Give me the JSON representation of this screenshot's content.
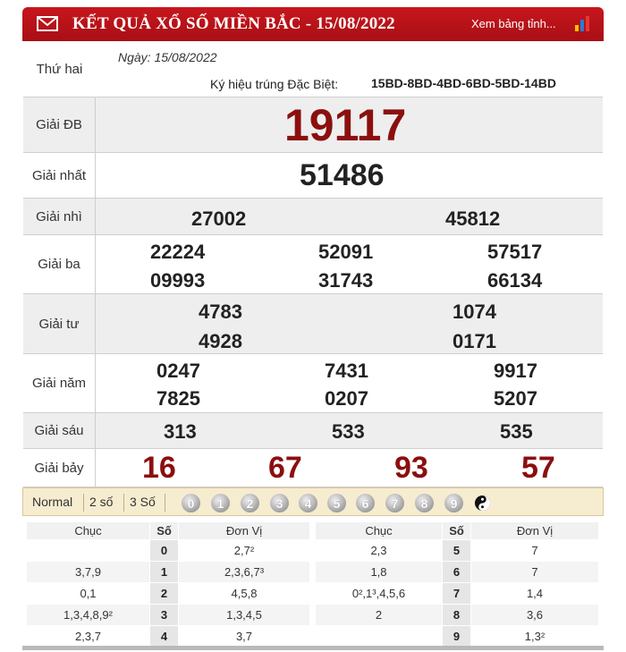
{
  "header": {
    "title": "KẾT QUẢ XỔ SỐ MIỀN BẮC - 15/08/2022",
    "link": "Xem bảng tỉnh...",
    "icons": [
      "envelope-icon",
      "bar-chart-icon"
    ],
    "color": "#c8161d"
  },
  "info": {
    "weekday": "Thứ hai",
    "date": "Ngày: 15/08/2022",
    "special_code_label": "Ký hiệu trúng Đặc Biệt:",
    "special_code": "15BD-8BD-4BD-6BD-5BD-14BD"
  },
  "prizes": {
    "db": {
      "label": "Giải ĐB",
      "numbers": [
        "19117"
      ]
    },
    "nhat": {
      "label": "Giải nhất",
      "numbers": [
        "51486"
      ]
    },
    "nhi": {
      "label": "Giải nhì",
      "numbers": [
        "27002",
        "45812"
      ]
    },
    "ba": {
      "label": "Giải ba",
      "numbers": [
        "22224",
        "52091",
        "57517",
        "09993",
        "31743",
        "66134"
      ]
    },
    "tu": {
      "label": "Giải tư",
      "numbers": [
        "4783",
        "1074",
        "4928",
        "0171"
      ]
    },
    "nam": {
      "label": "Giải năm",
      "numbers": [
        "0247",
        "7431",
        "9917",
        "7825",
        "0207",
        "5207"
      ]
    },
    "sau": {
      "label": "Giải sáu",
      "numbers": [
        "313",
        "533",
        "535"
      ]
    },
    "bay": {
      "label": "Giải bảy",
      "numbers": [
        "16",
        "67",
        "93",
        "57"
      ]
    },
    "accent_color": "#8b0f0f"
  },
  "tabs": {
    "items": [
      "Normal",
      "2 số",
      "3 Số"
    ],
    "digits": [
      "0",
      "1",
      "2",
      "3",
      "4",
      "5",
      "6",
      "7",
      "8",
      "9"
    ]
  },
  "loto": {
    "headers": {
      "chuc": "Chục",
      "so": "Số",
      "donvi": "Đơn Vị"
    },
    "left": [
      {
        "chuc": "",
        "so": "0",
        "donvi": "2,7²"
      },
      {
        "chuc": "3,7,9",
        "so": "1",
        "donvi": "2,3,6,7³"
      },
      {
        "chuc": "0,1",
        "so": "2",
        "donvi": "4,5,8"
      },
      {
        "chuc": "1,3,4,8,9²",
        "so": "3",
        "donvi": "1,3,4,5"
      },
      {
        "chuc": "2,3,7",
        "so": "4",
        "donvi": "3,7"
      }
    ],
    "right": [
      {
        "chuc": "2,3",
        "so": "5",
        "donvi": "7"
      },
      {
        "chuc": "1,8",
        "so": "6",
        "donvi": "7"
      },
      {
        "chuc": "0²,1³,4,5,6",
        "so": "7",
        "donvi": "1,4"
      },
      {
        "chuc": "2",
        "so": "8",
        "donvi": "3,6"
      },
      {
        "chuc": "",
        "so": "9",
        "donvi": "1,3²"
      }
    ]
  }
}
